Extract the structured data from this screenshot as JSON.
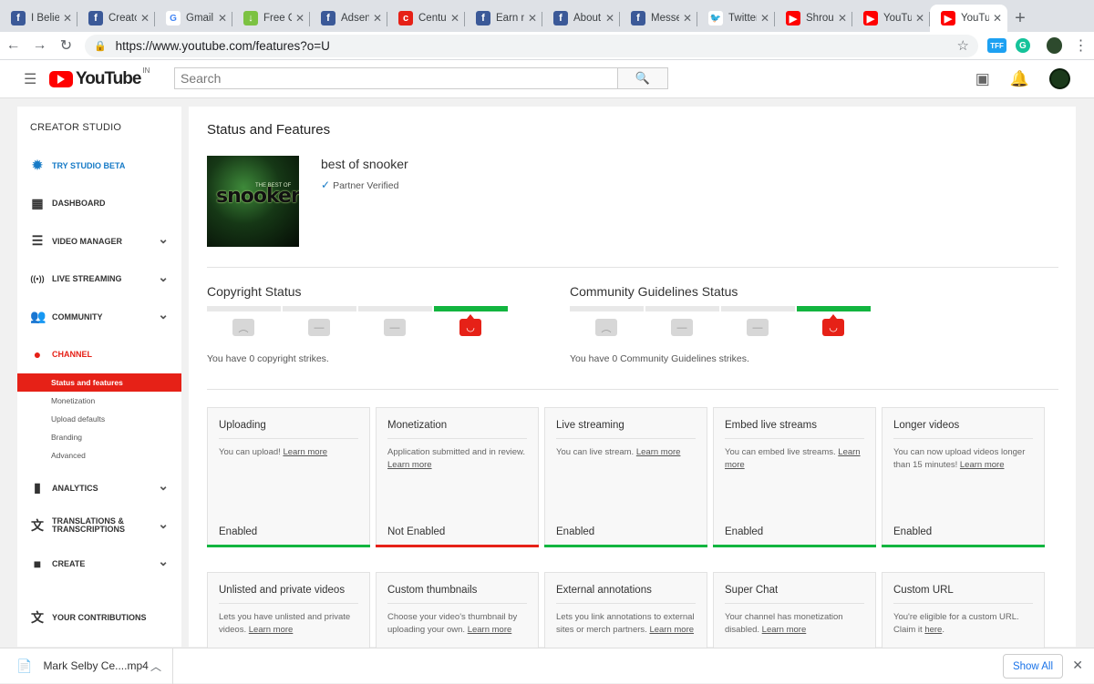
{
  "browser": {
    "tabs": [
      {
        "title": "I Believ",
        "icon": "facebook-icon",
        "color": "#3b5998",
        "glyph": "f"
      },
      {
        "title": "Creato",
        "icon": "facebook-icon",
        "color": "#3b5998",
        "glyph": "f"
      },
      {
        "title": "Gmail",
        "icon": "google-icon",
        "color": "#ffffff",
        "glyph": "G"
      },
      {
        "title": "Free O",
        "icon": "download-arrow-icon",
        "color": "#7cc242",
        "glyph": "↓"
      },
      {
        "title": "Adsens",
        "icon": "facebook-icon",
        "color": "#3b5998",
        "glyph": "f"
      },
      {
        "title": "Centur",
        "icon": "century-icon",
        "color": "#e62117",
        "glyph": "c"
      },
      {
        "title": "Earn m",
        "icon": "facebook-icon",
        "color": "#3b5998",
        "glyph": "f"
      },
      {
        "title": "About",
        "icon": "facebook-icon",
        "color": "#3b5998",
        "glyph": "f"
      },
      {
        "title": "Messe",
        "icon": "facebook-icon",
        "color": "#3b5998",
        "glyph": "f"
      },
      {
        "title": "Twitter",
        "icon": "twitter-icon",
        "color": "#ffffff",
        "glyph": "🐦"
      },
      {
        "title": "Shroud",
        "icon": "youtube-icon",
        "color": "#ff0000",
        "glyph": "▶"
      },
      {
        "title": "YouTub",
        "icon": "youtube-icon",
        "color": "#ff0000",
        "glyph": "▶"
      },
      {
        "title": "YouTub",
        "icon": "youtube-icon",
        "color": "#ff0000",
        "glyph": "▶",
        "active": true
      }
    ],
    "new_tab": "+",
    "url": "https://www.youtube.com/features?o=U",
    "ext1": "TFF",
    "ext2": "G"
  },
  "header": {
    "logo_text": "YouTube",
    "country": "IN",
    "search_placeholder": "Search"
  },
  "sidebar": {
    "title": "CREATOR STUDIO",
    "items": [
      {
        "label": "TRY STUDIO BETA",
        "icon": "gear-icon",
        "glyph": "✹",
        "style": "blue",
        "chev": false
      },
      {
        "label": "DASHBOARD",
        "icon": "dashboard-icon",
        "glyph": "▦",
        "style": "",
        "chev": false
      },
      {
        "label": "VIDEO MANAGER",
        "icon": "video-manager-icon",
        "glyph": "☰",
        "style": "",
        "chev": true
      },
      {
        "label": "LIVE STREAMING",
        "icon": "live-icon",
        "glyph": "((•))",
        "style": "",
        "chev": true
      },
      {
        "label": "COMMUNITY",
        "icon": "community-icon",
        "glyph": "👥",
        "style": "",
        "chev": true
      },
      {
        "label": "CHANNEL",
        "icon": "channel-icon",
        "glyph": "●",
        "style": "red",
        "chev": false
      }
    ],
    "channel_sub": [
      "Status and features",
      "Monetization",
      "Upload defaults",
      "Branding",
      "Advanced"
    ],
    "items2": [
      {
        "label": "ANALYTICS",
        "icon": "analytics-icon",
        "glyph": "▮",
        "chev": true
      },
      {
        "label": "TRANSLATIONS & TRANSCRIPTIONS",
        "icon": "translate-icon",
        "glyph": "文",
        "chev": true
      },
      {
        "label": "CREATE",
        "icon": "camera-icon",
        "glyph": "■",
        "chev": true
      },
      {
        "label": "YOUR CONTRIBUTIONS",
        "icon": "contributions-icon",
        "glyph": "文",
        "chev": false
      }
    ]
  },
  "main": {
    "title": "Status and Features",
    "thumb_text": "snooker",
    "thumb_small": "THE BEST OF",
    "channel_name": "best of snooker",
    "verified": "Partner Verified",
    "copyright": {
      "title": "Copyright Status",
      "text": "You have 0 copyright strikes."
    },
    "community": {
      "title": "Community Guidelines Status",
      "text": "You have 0 Community Guidelines strikes."
    },
    "features": [
      {
        "title": "Uploading",
        "desc": "You can upload!",
        "link": "Learn more",
        "status": "Enabled",
        "color": "#12b53f"
      },
      {
        "title": "Monetization",
        "desc": "Application submitted and in review.",
        "link": "Learn more",
        "status": "Not Enabled",
        "color": "#e62117"
      },
      {
        "title": "Live streaming",
        "desc": "You can live stream.",
        "link": "Learn more",
        "status": "Enabled",
        "color": "#12b53f"
      },
      {
        "title": "Embed live streams",
        "desc": "You can embed live streams.",
        "link": "Learn more",
        "status": "Enabled",
        "color": "#12b53f"
      },
      {
        "title": "Longer videos",
        "desc": "You can now upload videos longer than 15 minutes!",
        "link": "Learn more",
        "status": "Enabled",
        "color": "#12b53f"
      }
    ],
    "features2": [
      {
        "title": "Unlisted and private videos",
        "desc": "Lets you have unlisted and private videos.",
        "link": "Learn more"
      },
      {
        "title": "Custom thumbnails",
        "desc": "Choose your video's thumbnail by uploading your own.",
        "link": "Learn more"
      },
      {
        "title": "External annotations",
        "desc": "Lets you link annotations to external sites or merch partners.",
        "link": "Learn more"
      },
      {
        "title": "Super Chat",
        "desc": "Your channel has monetization disabled.",
        "link": "Learn more"
      },
      {
        "title": "Custom URL",
        "desc": "You're eligible for a custom URL. Claim it",
        "link": "here",
        "suffix": "."
      }
    ]
  },
  "downloads": {
    "file": "Mark Selby Ce....mp4",
    "show_all": "Show All"
  }
}
